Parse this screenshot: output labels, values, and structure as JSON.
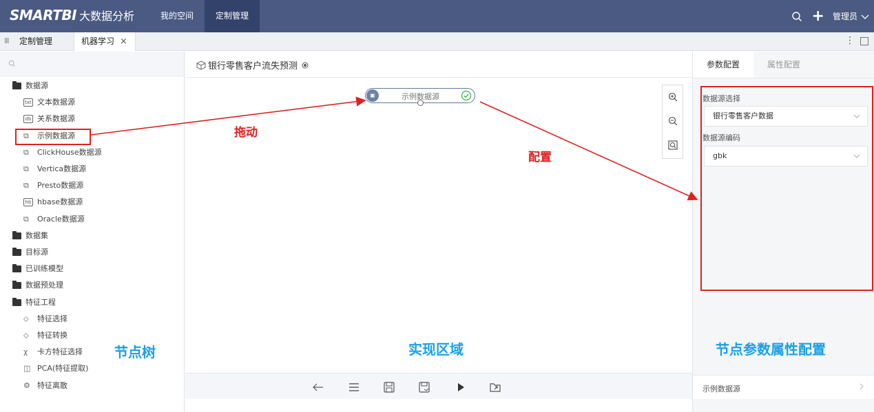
{
  "topbar": {
    "brand": "SMARTBI",
    "product": "大数据分析",
    "nav": [
      "我的空间",
      "定制管理"
    ],
    "user": "管理员",
    "colors": {
      "bg": "#4a5a82",
      "active": "#33426a"
    }
  },
  "tabs": {
    "items": [
      "定制管理",
      "机器学习"
    ],
    "close_icon": "×"
  },
  "tree": {
    "items": [
      {
        "label": "数据源",
        "icon": "folder-open-icon"
      },
      {
        "label": "文本数据源",
        "icon": "text-datasource-icon"
      },
      {
        "label": "关系数据源",
        "icon": "relational-datasource-icon"
      },
      {
        "label": "示例数据源",
        "icon": "sample-datasource-icon"
      },
      {
        "label": "ClickHouse数据源",
        "icon": "clickhouse-datasource-icon"
      },
      {
        "label": "Vertica数据源",
        "icon": "vertica-datasource-icon"
      },
      {
        "label": "Presto数据源",
        "icon": "presto-datasource-icon"
      },
      {
        "label": "hbase数据源",
        "icon": "hbase-datasource-icon"
      },
      {
        "label": "Oracle数据源",
        "icon": "oracle-datasource-icon"
      },
      {
        "label": "数据集",
        "icon": "folder-icon"
      },
      {
        "label": "目标源",
        "icon": "folder-icon"
      },
      {
        "label": "已训练模型",
        "icon": "folder-icon"
      },
      {
        "label": "数据预处理",
        "icon": "folder-icon"
      },
      {
        "label": "特征工程",
        "icon": "folder-open-icon"
      },
      {
        "label": "特征选择",
        "icon": "feature-select-icon"
      },
      {
        "label": "特征转换",
        "icon": "feature-transform-icon"
      },
      {
        "label": "卡方特征选择",
        "icon": "chi-square-icon"
      },
      {
        "label": "PCA(特征提取)",
        "icon": "pca-icon"
      },
      {
        "label": "特征离散",
        "icon": "discretize-icon"
      }
    ]
  },
  "canvas": {
    "title": "银行零售客户流失预测",
    "node_label": "示例数据源"
  },
  "annotations": {
    "drag": "拖动",
    "configure": "配置",
    "node_tree": "节点树",
    "work_area": "实现区域",
    "node_config": "节点参数属性配置",
    "colors": {
      "red": "#e02020",
      "blue": "#1aa0e6"
    }
  },
  "right_panel": {
    "tabs": [
      "参数配置",
      "属性配置"
    ],
    "field1_label": "数据源选择",
    "field1_value": "银行零售客户数据",
    "field2_label": "数据源编码",
    "field2_value": "gbk",
    "footer_label": "示例数据源"
  }
}
